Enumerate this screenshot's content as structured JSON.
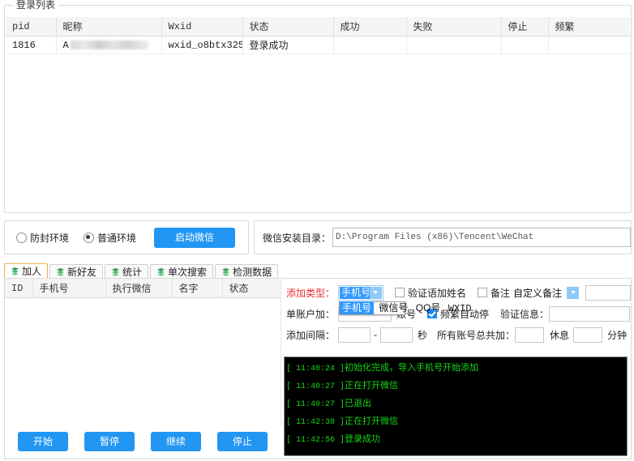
{
  "login_group": {
    "title": "登录列表",
    "columns": [
      "pid",
      "昵称",
      "Wxid",
      "状态",
      "成功",
      "失败",
      "停止",
      "频繁"
    ],
    "rows": [
      {
        "pid": "1816",
        "nickname_prefix": "A",
        "nickname_masked": true,
        "wxid": "wxid_o8btx325...",
        "status": "登录成功",
        "success": "",
        "fail": "",
        "stop": "",
        "frequent": ""
      }
    ]
  },
  "env_bar": {
    "options": [
      {
        "label": "防封环境",
        "selected": false
      },
      {
        "label": "普通环境",
        "selected": true
      }
    ],
    "start_button": "启动微信"
  },
  "install_dir": {
    "label": "微信安装目录：",
    "value": "D:\\Program Files (x86)\\Tencent\\WeChat"
  },
  "tabs": [
    {
      "label": "加人",
      "active": true
    },
    {
      "label": "新好友",
      "active": false
    },
    {
      "label": "统计",
      "active": false
    },
    {
      "label": "单次搜索",
      "active": false
    },
    {
      "label": "检测数据",
      "active": false
    }
  ],
  "phone_table": {
    "columns": [
      "ID",
      "手机号",
      "执行微信",
      "名字",
      "状态"
    ],
    "rows": []
  },
  "bottom_buttons": [
    {
      "label": "开始"
    },
    {
      "label": "暂停"
    },
    {
      "label": "继续"
    },
    {
      "label": "停止"
    }
  ],
  "controls": {
    "add_type": {
      "label": "添加类型：",
      "value": "手机号",
      "options": [
        "手机号",
        "微信号",
        "QQ号",
        "WXID"
      ],
      "open": true
    },
    "verify_name_checkbox": {
      "label": "验证语加姓名",
      "checked": false
    },
    "remark_checkbox": {
      "label": "备注",
      "checked": false
    },
    "remark_type": {
      "value": "自定义备注"
    },
    "remark_input": {
      "value": ""
    },
    "single_account": {
      "label": "单账户加：",
      "value": "",
      "suffix": "账号"
    },
    "auto_stop_checkbox": {
      "label": "频繁自动停",
      "checked": true
    },
    "verify_info": {
      "label": "验证信息：",
      "value": ""
    },
    "interval": {
      "label": "添加间隔：",
      "from": "",
      "separator": "-",
      "to": "",
      "unit": "秒"
    },
    "total_all_accounts": {
      "label": "所有账号总共加：",
      "value": "",
      "rest_label": "休息",
      "rest_value": "",
      "rest_unit": "分钟"
    }
  },
  "console_logs": [
    {
      "time": "11:40:24",
      "message": "初始化完成，导入手机号开始添加"
    },
    {
      "time": "11:40:27",
      "message": "正在打开微信"
    },
    {
      "time": "11:40:27",
      "message": "已退出"
    },
    {
      "time": "11:42:38",
      "message": "正在打开微信"
    },
    {
      "time": "11:42:56",
      "message": "登录成功"
    }
  ],
  "colors": {
    "accent": "#2196f3",
    "label_red": "#e8312e",
    "console_text": "#16d716",
    "select_highlight": "#3399ff",
    "tab_active_border": "#e8b04b"
  }
}
